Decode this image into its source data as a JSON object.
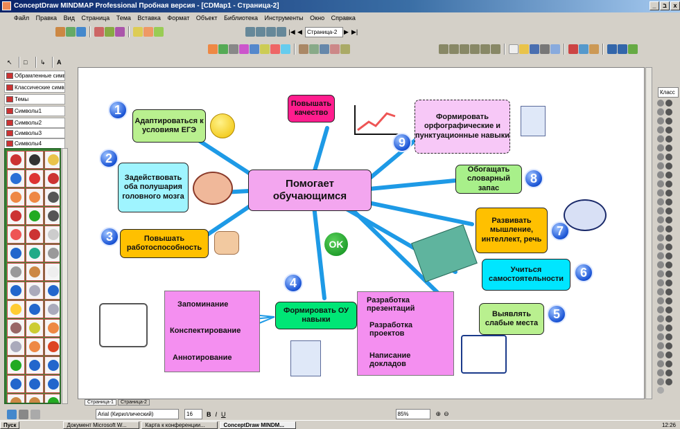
{
  "window": {
    "title": "ConceptDraw MINDMAP Professional Пробная версия - [CDMap1 - Страница-2]",
    "btn_min": "_",
    "btn_max": "ב",
    "btn_close": "x"
  },
  "menu": [
    "Файл",
    "Правка",
    "Вид",
    "Страница",
    "Тема",
    "Вставка",
    "Формат",
    "Объект",
    "Библиотека",
    "Инструменты",
    "Окно",
    "Справка"
  ],
  "toolbar": {
    "page_select": "Страница-2"
  },
  "libraries": [
    "Обрамленные симв",
    "Классические симв",
    "Темы",
    "Символы1",
    "Символы2",
    "Символы3",
    "Символы4"
  ],
  "right_panel": {
    "class_select": "Класс"
  },
  "map": {
    "center": "Помогает обучающимся",
    "ok_label": "OK",
    "branches": [
      {
        "num": "1",
        "text": "Адаптироваться к условиям ЕГЭ"
      },
      {
        "num": "2",
        "text": "Задействовать оба полушария головного мозга"
      },
      {
        "num": "3",
        "text": "Повышать работоспособность"
      },
      {
        "num": "4",
        "text": "Формировать ОУ навыки"
      },
      {
        "num": "5",
        "text": "Выявлять слабые места"
      },
      {
        "num": "6",
        "text": "Учиться самостоятельности"
      },
      {
        "num": "7",
        "text": "Развивать мышление, интеллект, речь"
      },
      {
        "num": "8",
        "text": "Обогащать словарный запас"
      },
      {
        "num": "9",
        "text": "Формировать орфографические и пунктуационные навыки"
      },
      {
        "num": "",
        "text": "Повышать качество"
      }
    ],
    "left_leaves": [
      "Запоминание",
      "Конспектирование",
      "Аннотирование"
    ],
    "right_leaves": [
      "Разработка презентаций",
      "Разработка проектов",
      "Написание докладов"
    ]
  },
  "page_tabs": [
    "Страница-1",
    "Страница-2"
  ],
  "status": {
    "font": "Arial (Кириллический)",
    "size": "16",
    "zoom": "85%"
  },
  "taskbar": {
    "start": "Пуск",
    "items": [
      "Документ Microsoft W...",
      "Карта к конференции...",
      "ConceptDraw MINDM..."
    ],
    "clock": "12:26"
  },
  "colors": {
    "center": "#f3a6ef",
    "branch_line": "#1e9ae6",
    "yellow": "#ffc000",
    "green": "#b9f08f",
    "cyan": "#00e6ff",
    "pink": "#f48ff0",
    "lightcyan": "#9ff4ff",
    "lightgreen": "#a8f08a",
    "magenta": "#ff1d8e",
    "lavender": "#f7c8f7"
  }
}
